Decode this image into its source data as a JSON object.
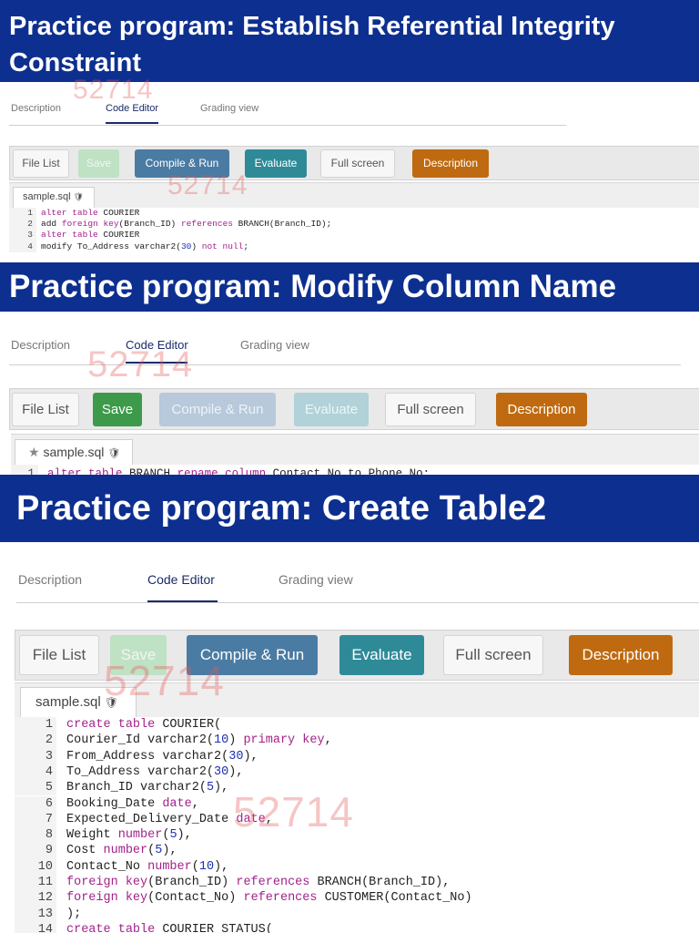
{
  "watermark": "52714",
  "panels": [
    {
      "title_line1": "Practice program: Establish Referential Integrity",
      "title_line2": "Constraint",
      "tabs": [
        "Description",
        "Code Editor",
        "Grading view"
      ],
      "toolbar": [
        "File List",
        "Save",
        "Compile & Run",
        "Evaluate",
        "Full screen",
        "Description"
      ],
      "file_tab": "sample.sql",
      "lines": [
        {
          "n": "1",
          "parts": [
            [
              "alter",
              "kw"
            ],
            [
              " "
            ],
            [
              "table",
              "kw"
            ],
            [
              " COURIER"
            ]
          ]
        },
        {
          "n": "2",
          "parts": [
            [
              "add "
            ],
            [
              "foreign",
              "kw"
            ],
            [
              " "
            ],
            [
              "key",
              "kw"
            ],
            [
              "(Branch_ID) "
            ],
            [
              "references",
              "kw"
            ],
            [
              " BRANCH(Branch_ID);"
            ]
          ]
        },
        {
          "n": "3",
          "parts": [
            [
              "alter",
              "kw"
            ],
            [
              " "
            ],
            [
              "table",
              "kw"
            ],
            [
              " COURIER"
            ]
          ]
        },
        {
          "n": "4",
          "parts": [
            [
              "modify To_Address varchar2("
            ],
            [
              "30",
              "num"
            ],
            [
              ") "
            ],
            [
              "not null",
              "kw"
            ],
            [
              ";"
            ]
          ]
        }
      ]
    },
    {
      "title_line1": "Practice program: Modify Column Name",
      "tabs": [
        "Description",
        "Code Editor",
        "Grading view"
      ],
      "toolbar": [
        "File List",
        "Save",
        "Compile & Run",
        "Evaluate",
        "Full screen",
        "Description"
      ],
      "file_tab": "sample.sql",
      "lines": [
        {
          "n": "1",
          "parts": [
            [
              "alter",
              "kw"
            ],
            [
              " "
            ],
            [
              "table",
              "kw"
            ],
            [
              " BRANCH "
            ],
            [
              "rename",
              "kw"
            ],
            [
              " "
            ],
            [
              "column",
              "kw"
            ],
            [
              " Contact_No to Phone_No;"
            ]
          ]
        }
      ]
    },
    {
      "title_line1": "Practice program: Create Table2",
      "tabs": [
        "Description",
        "Code Editor",
        "Grading view"
      ],
      "toolbar": [
        "File List",
        "Save",
        "Compile & Run",
        "Evaluate",
        "Full screen",
        "Description"
      ],
      "file_tab": "sample.sql",
      "lines": [
        {
          "n": "1",
          "parts": [
            [
              "create",
              "kw"
            ],
            [
              " "
            ],
            [
              "table",
              "kw"
            ],
            [
              " COURIER("
            ]
          ]
        },
        {
          "n": "2",
          "parts": [
            [
              "Courier_Id varchar2("
            ],
            [
              "10",
              "num"
            ],
            [
              ") "
            ],
            [
              "primary key",
              "kw"
            ],
            [
              ","
            ]
          ]
        },
        {
          "n": "3",
          "parts": [
            [
              "From_Address varchar2("
            ],
            [
              "30",
              "num"
            ],
            [
              "),"
            ]
          ]
        },
        {
          "n": "4",
          "parts": [
            [
              "To_Address varchar2("
            ],
            [
              "30",
              "num"
            ],
            [
              "),"
            ]
          ]
        },
        {
          "n": "5",
          "parts": [
            [
              "Branch_ID varchar2("
            ],
            [
              "5",
              "num"
            ],
            [
              "),"
            ]
          ]
        },
        {
          "n": "6",
          "parts": [
            [
              "Booking_Date "
            ],
            [
              "date",
              "kw"
            ],
            [
              ","
            ]
          ]
        },
        {
          "n": "7",
          "parts": [
            [
              "Expected_Delivery_Date "
            ],
            [
              "date",
              "kw"
            ],
            [
              ","
            ]
          ]
        },
        {
          "n": "8",
          "parts": [
            [
              "Weight "
            ],
            [
              "number",
              "kw"
            ],
            [
              "("
            ],
            [
              "5",
              "num"
            ],
            [
              "),"
            ]
          ]
        },
        {
          "n": "9",
          "parts": [
            [
              "Cost "
            ],
            [
              "number",
              "kw"
            ],
            [
              "("
            ],
            [
              "5",
              "num"
            ],
            [
              "),"
            ]
          ]
        },
        {
          "n": "10",
          "parts": [
            [
              "Contact_No "
            ],
            [
              "number",
              "kw"
            ],
            [
              "("
            ],
            [
              "10",
              "num"
            ],
            [
              "),"
            ]
          ]
        },
        {
          "n": "11",
          "parts": [
            [
              "foreign",
              "kw"
            ],
            [
              " "
            ],
            [
              "key",
              "kw"
            ],
            [
              "(Branch_ID) "
            ],
            [
              "references",
              "kw"
            ],
            [
              " BRANCH(Branch_ID),"
            ]
          ]
        },
        {
          "n": "12",
          "parts": [
            [
              "foreign",
              "kw"
            ],
            [
              " "
            ],
            [
              "key",
              "kw"
            ],
            [
              "(Contact_No) "
            ],
            [
              "references",
              "kw"
            ],
            [
              " CUSTOMER(Contact_No)"
            ]
          ]
        },
        {
          "n": "13",
          "parts": [
            [
              ");"
            ]
          ]
        },
        {
          "n": "14",
          "parts": [
            [
              "create",
              "kw"
            ],
            [
              " "
            ],
            [
              "table",
              "kw"
            ],
            [
              " COURIER_STATUS("
            ]
          ]
        }
      ]
    }
  ]
}
